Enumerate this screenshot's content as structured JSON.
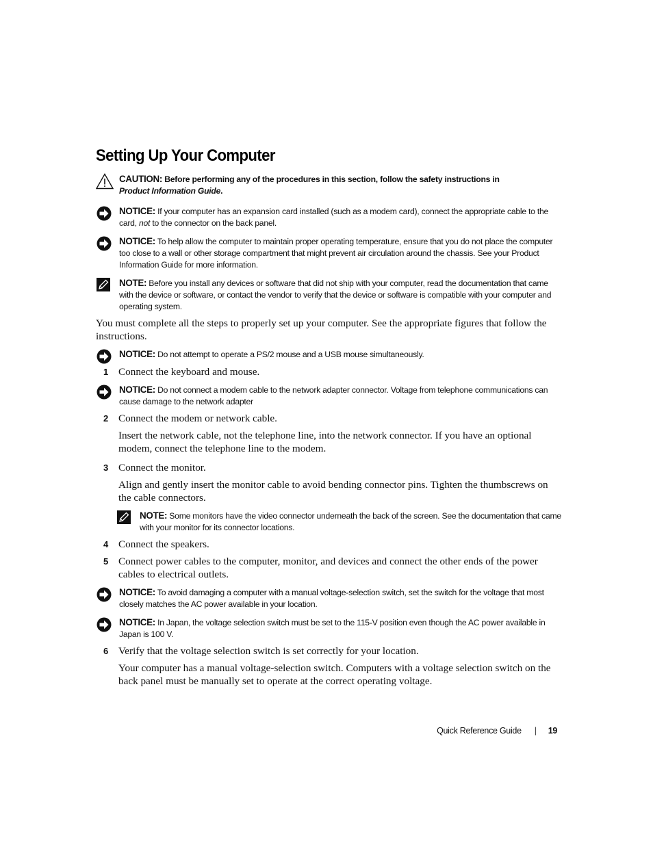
{
  "page": {
    "title": "Setting Up Your Computer",
    "caution": {
      "icon": "warning-triangle-icon",
      "label": "CAUTION:",
      "text": "Before performing any of the procedures in this section, follow the safety instructions in",
      "italic": "Product Information Guide",
      "end": "."
    },
    "notice_expansion": {
      "icon": "notice-arrow-icon",
      "label": "NOTICE:",
      "text_before": "If your computer has an expansion card installed (such as a modem card), connect the appropriate cable to the card,",
      "italic": "not",
      "text_after": "to the connector on the back panel."
    },
    "notice_temperature": {
      "icon": "notice-arrow-icon",
      "label": "NOTICE:",
      "text": "To help allow the computer to maintain proper operating temperature, ensure that you do not place the computer too close to a wall or other storage compartment that might prevent air circulation around the chassis. See your Product Information Guide for more information."
    },
    "note_devices": {
      "icon": "note-pencil-icon",
      "label": "NOTE:",
      "text": "Before you install any devices or software that did not ship with your computer, read the documentation that came with the device or software, or contact the vendor to verify that the device or software is compatible with your computer and operating system."
    },
    "intro": "You must complete all the steps to properly set up your computer. See the appropriate figures that follow the instructions.",
    "notice_mouse": {
      "icon": "notice-arrow-icon",
      "label": "NOTICE:",
      "text": "Do not attempt to operate a PS/2 mouse and a USB mouse simultaneously."
    },
    "steps": [
      {
        "num": "1",
        "text": "Connect the keyboard and mouse."
      },
      {
        "num": "2",
        "text": "Connect the modem or network cable.",
        "detail": "Insert the network cable, not the telephone line, into the network connector. If you have an optional modem, connect the telephone line to the modem."
      },
      {
        "num": "3",
        "text": "Connect the monitor.",
        "detail": "Align and gently insert the monitor cable to avoid bending connector pins. Tighten the thumbscrews on the cable connectors."
      },
      {
        "num": "4",
        "text": "Connect the speakers."
      },
      {
        "num": "5",
        "text": "Connect power cables to the computer, monitor, and devices and connect the other ends of the power cables to electrical outlets."
      },
      {
        "num": "6",
        "text": "Verify that the voltage selection switch is set correctly for your location.",
        "detail": "Your computer has a manual voltage-selection switch. Computers with a voltage selection switch on the back panel must be manually set to operate at the correct operating voltage."
      }
    ],
    "notice_modem": {
      "icon": "notice-arrow-icon",
      "label": "NOTICE:",
      "text": "Do not connect a modem cable to the network adapter connector. Voltage from telephone communications can cause damage to the network adapter"
    },
    "note_monitor": {
      "icon": "note-pencil-icon",
      "label": "NOTE:",
      "text": "Some monitors have the video connector underneath the back of the screen. See the documentation that came with your monitor for its connector locations."
    },
    "notice_voltage": {
      "icon": "notice-arrow-icon",
      "label": "NOTICE:",
      "text": "To avoid damaging a computer with a manual voltage-selection switch, set the switch for the voltage that most closely matches the AC power available in your location."
    },
    "notice_japan": {
      "icon": "notice-arrow-icon",
      "label": "NOTICE:",
      "text": "In Japan, the voltage selection switch must be set to the 115-V position even though the AC power available in Japan is 100 V."
    },
    "footer": {
      "guide": "Quick Reference Guide",
      "separator": "|",
      "page_number": "19"
    }
  }
}
